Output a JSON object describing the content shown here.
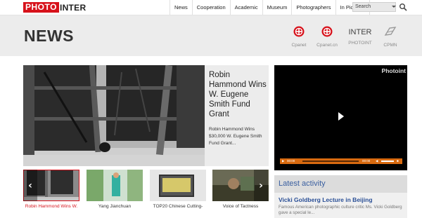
{
  "logo": {
    "red_part": "PHOTO",
    "black_part": "INTER"
  },
  "nav": [
    {
      "label": "News"
    },
    {
      "label": "Cooperation"
    },
    {
      "label": "Academic"
    },
    {
      "label": "Museum"
    },
    {
      "label": "Photographers"
    },
    {
      "label": "In Pictures"
    }
  ],
  "search": {
    "value": "Search"
  },
  "header": {
    "title": "NEWS",
    "partners": [
      {
        "label": "Cpanet",
        "icon": "cpanet-logo-icon"
      },
      {
        "label": "Cpanet.cn",
        "icon": "cpanet-cn-logo-icon"
      },
      {
        "label": "PHOTOINT",
        "word": "INTER"
      },
      {
        "label": "CPMN",
        "icon": "cpmn-logo-icon"
      }
    ]
  },
  "feature": {
    "headline": "Robin Hammond Wins W. Eugene Smith Fund Grant",
    "summary": "Robin Hammond Wins $30,000 W. Eugene Smith Fund Grant..."
  },
  "video": {
    "brand": "Photoint",
    "time_elapsed": "00:00",
    "time_total": "00:00"
  },
  "thumbnails": [
    {
      "caption": "Robin Hammond Wins W.",
      "active": true
    },
    {
      "caption": "Yang Jianchuan",
      "active": false
    },
    {
      "caption": "TOP20 Chinese Cutting-",
      "active": false
    },
    {
      "caption": "Voice of Tactness",
      "active": false
    }
  ],
  "activity": {
    "heading": "Latest activity",
    "title": "Vicki Goldberg Lecture in Beijing",
    "text": "Famous American photographic culture critic Ms. Vicki Goldberg gave a special le..."
  },
  "colors": {
    "brand_red": "#d7121b",
    "video_orange": "#d86a10",
    "link_blue": "#2a4f96"
  }
}
